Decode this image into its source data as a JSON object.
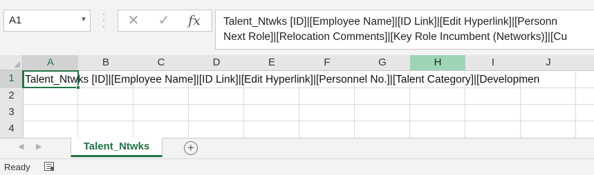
{
  "namebox": {
    "value": "A1"
  },
  "formula_bar": {
    "cancel_icon": "✕",
    "enter_icon": "✓",
    "fx_label": "fx",
    "line1": "Talent_Ntwks [ID]|[Employee Name]|[ID Link]|[Edit Hyperlink]|[Personn",
    "line2": "Next Role]|[Relocation Comments]|[Key Role Incumbent (Networks)]|[Cu"
  },
  "columns": [
    "A",
    "B",
    "C",
    "D",
    "E",
    "F",
    "G",
    "H",
    "I",
    "J"
  ],
  "rows": [
    "1",
    "2",
    "3",
    "4"
  ],
  "cells": {
    "A1": "Talent_Ntwks [ID]|[Employee Name]|[ID Link]|[Edit Hyperlink]|[Personnel No.]|[Talent Category]|[Developmen"
  },
  "sheet_tabs": [
    {
      "label": "Talent_Ntwks",
      "active": true
    }
  ],
  "add_sheet": "+",
  "status": {
    "text": "Ready"
  },
  "colors": {
    "accent": "#217346",
    "highlight_col": "#9fd5b7"
  }
}
